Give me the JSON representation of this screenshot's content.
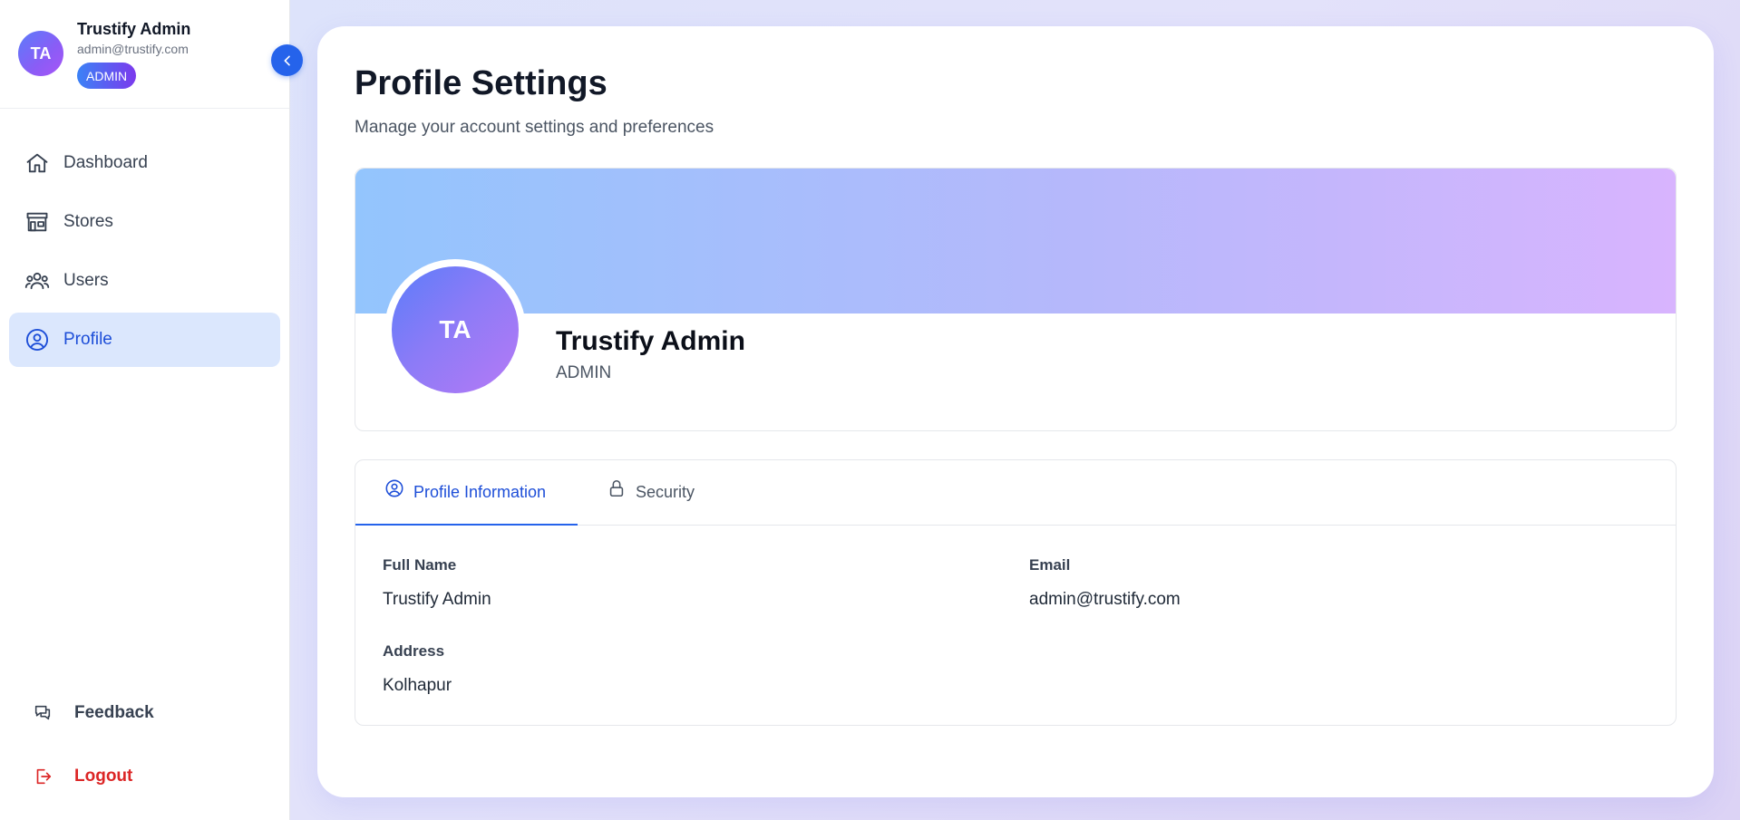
{
  "sidebar": {
    "user": {
      "initials": "TA",
      "name": "Trustify Admin",
      "email": "admin@trustify.com",
      "role": "ADMIN"
    },
    "nav": [
      {
        "label": "Dashboard",
        "icon": "home-icon",
        "active": false
      },
      {
        "label": "Stores",
        "icon": "store-icon",
        "active": false
      },
      {
        "label": "Users",
        "icon": "users-icon",
        "active": false
      },
      {
        "label": "Profile",
        "icon": "user-circle-icon",
        "active": true
      }
    ],
    "feedback_label": "Feedback",
    "logout_label": "Logout"
  },
  "main": {
    "title": "Profile Settings",
    "subtitle": "Manage your account settings and preferences",
    "profile": {
      "initials": "TA",
      "name": "Trustify Admin",
      "role": "ADMIN"
    },
    "tabs": [
      {
        "label": "Profile Information",
        "icon": "user-circle-icon",
        "active": true
      },
      {
        "label": "Security",
        "icon": "lock-icon",
        "active": false
      }
    ],
    "fields": {
      "full_name_label": "Full Name",
      "full_name_value": "Trustify Admin",
      "email_label": "Email",
      "email_value": "admin@trustify.com",
      "address_label": "Address",
      "address_value": "Kolhapur"
    }
  },
  "colors": {
    "accent": "#2563eb",
    "active_bg": "#dbe7fd",
    "logout": "#dc2626"
  }
}
